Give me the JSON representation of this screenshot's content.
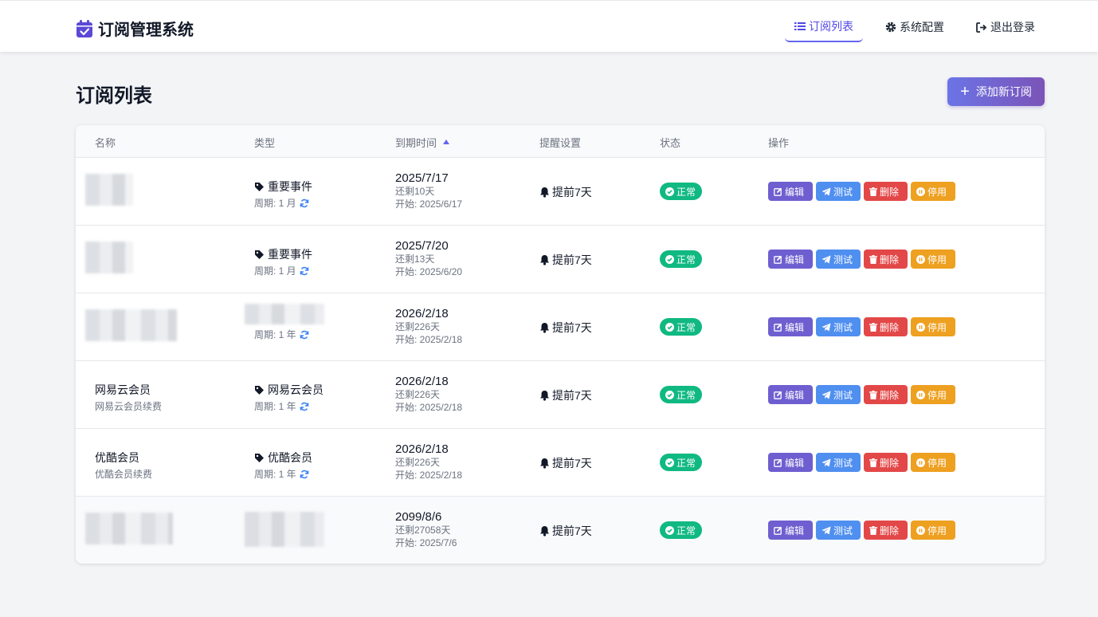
{
  "app": {
    "title": "订阅管理系统"
  },
  "nav": {
    "list_label": "订阅列表",
    "config_label": "系统配置",
    "logout_label": "退出登录"
  },
  "page": {
    "title": "订阅列表",
    "add_label": "添加新订阅"
  },
  "table": {
    "headers": {
      "name": "名称",
      "type": "类型",
      "expiry": "到期时间",
      "remind": "提醒设置",
      "status": "状态",
      "actions": "操作"
    },
    "sort": "expiry-ascending",
    "action_labels": {
      "edit": "编辑",
      "test": "测试",
      "delete": "删除",
      "disable": "停用"
    },
    "rows": [
      {
        "name": "",
        "note": "",
        "type": "重要事件",
        "period": "周期: 1 月",
        "expiry": "2025/7/17",
        "remaining": "还剩10天",
        "start": "开始: 2025/6/17",
        "remind": "提前7天",
        "status": "正常"
      },
      {
        "name": "",
        "note": "",
        "type": "重要事件",
        "period": "周期: 1 月",
        "expiry": "2025/7/20",
        "remaining": "还剩13天",
        "start": "开始: 2025/6/20",
        "remind": "提前7天",
        "status": "正常"
      },
      {
        "name": "",
        "note": "",
        "type": "",
        "period": "周期: 1 年",
        "expiry": "2026/2/18",
        "remaining": "还剩226天",
        "start": "开始: 2025/2/18",
        "remind": "提前7天",
        "status": "正常"
      },
      {
        "name": "网易云会员",
        "note": "网易云会员续费",
        "type": "网易云会员",
        "period": "周期: 1 年",
        "expiry": "2026/2/18",
        "remaining": "还剩226天",
        "start": "开始: 2025/2/18",
        "remind": "提前7天",
        "status": "正常"
      },
      {
        "name": "优酷会员",
        "note": "优酷会员续费",
        "type": "优酷会员",
        "period": "周期: 1 年",
        "expiry": "2026/2/18",
        "remaining": "还剩226天",
        "start": "开始: 2025/2/18",
        "remind": "提前7天",
        "status": "正常"
      },
      {
        "name": "",
        "note": "",
        "type": "",
        "period": "",
        "expiry": "2099/8/6",
        "remaining": "还剩27058天",
        "start": "开始: 2025/7/6",
        "remind": "提前7天",
        "status": "正常"
      }
    ]
  },
  "icons": {
    "brand": "calendar-check-icon",
    "nav_list": "list-icon",
    "nav_config": "gear-icon",
    "nav_logout": "sign-out-icon",
    "add": "plus-icon",
    "type": "tag-icon",
    "period": "sync-icon",
    "remind": "bell-icon",
    "status": "check-circle-icon",
    "edit": "edit-icon",
    "test": "paper-plane-icon",
    "delete": "trash-icon",
    "disable": "pause-circle-icon"
  },
  "colors": {
    "accent": "#6366f1",
    "status_ok": "#10b981",
    "edit": "#6d5fd0",
    "test": "#4f8ff0",
    "delete": "#e34848",
    "disable": "#eea020"
  }
}
